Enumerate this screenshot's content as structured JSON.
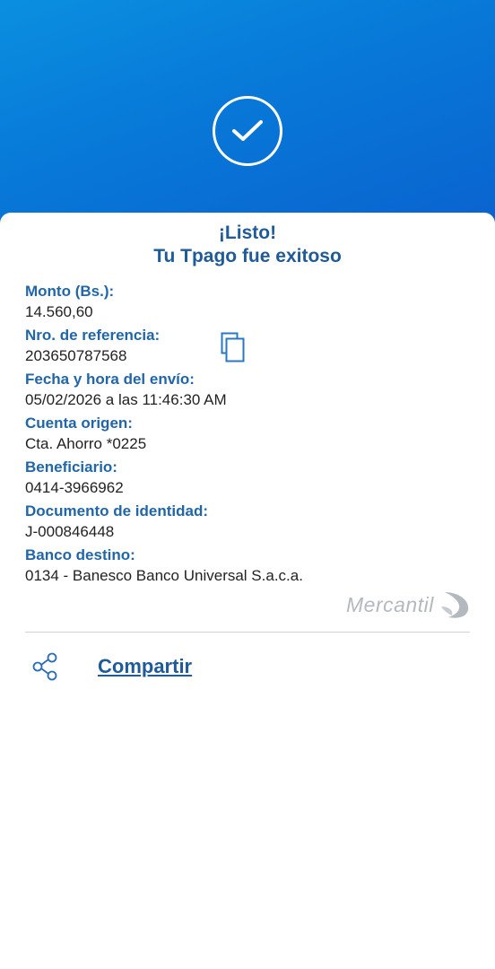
{
  "header": {
    "status_icon": "check-circle-icon"
  },
  "card": {
    "title_line1": "¡Listo!",
    "title_line2": "Tu Tpago fue exitoso"
  },
  "fields": [
    {
      "label": "Monto (Bs.):",
      "value": "14.560,60"
    },
    {
      "label": "Nro. de referencia:",
      "value": "203650787568"
    },
    {
      "label": "Fecha y hora del envío:",
      "value": "05/02/2026 a las 11:46:30 AM"
    },
    {
      "label": "Cuenta origen:",
      "value": "Cta. Ahorro *0225"
    },
    {
      "label": "Beneficiario:",
      "value": "0414-3966962"
    },
    {
      "label": "Documento de identidad:",
      "value": "J-000846448"
    },
    {
      "label": "Banco destino:",
      "value": "0134 - Banesco Banco Universal S.a.c.a."
    }
  ],
  "copy": {
    "icon": "copy-icon"
  },
  "brand": {
    "name": "Mercantil",
    "logo_icon": "mercantil-wing-icon"
  },
  "actions": {
    "share_label": "Compartir",
    "share_icon": "share-icon"
  },
  "colors": {
    "hero_start": "#0a8fe0",
    "hero_end": "#0a62cf",
    "accent": "#1f5b98",
    "label": "#2066a8"
  }
}
